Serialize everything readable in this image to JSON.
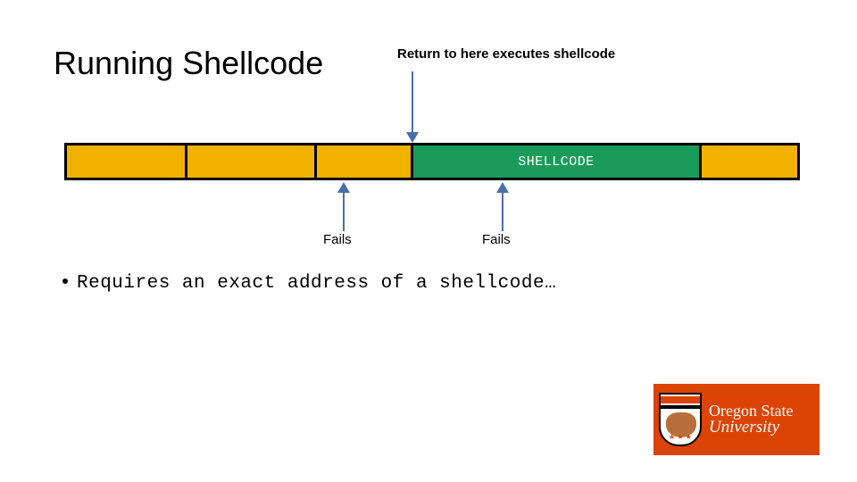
{
  "title": "Running Shellcode",
  "annotation_top": "Return to here executes shellcode",
  "bar": {
    "green_label": "SHELLCODE"
  },
  "labels": {
    "fails1": "Fails",
    "fails2": "Fails"
  },
  "bullet": "Requires an exact address of a shellcode…",
  "logo": {
    "line1": "Oregon State",
    "line2": "University"
  },
  "colors": {
    "yellow": "#f4b200",
    "green": "#1a9b5a",
    "orange": "#dc4405"
  }
}
